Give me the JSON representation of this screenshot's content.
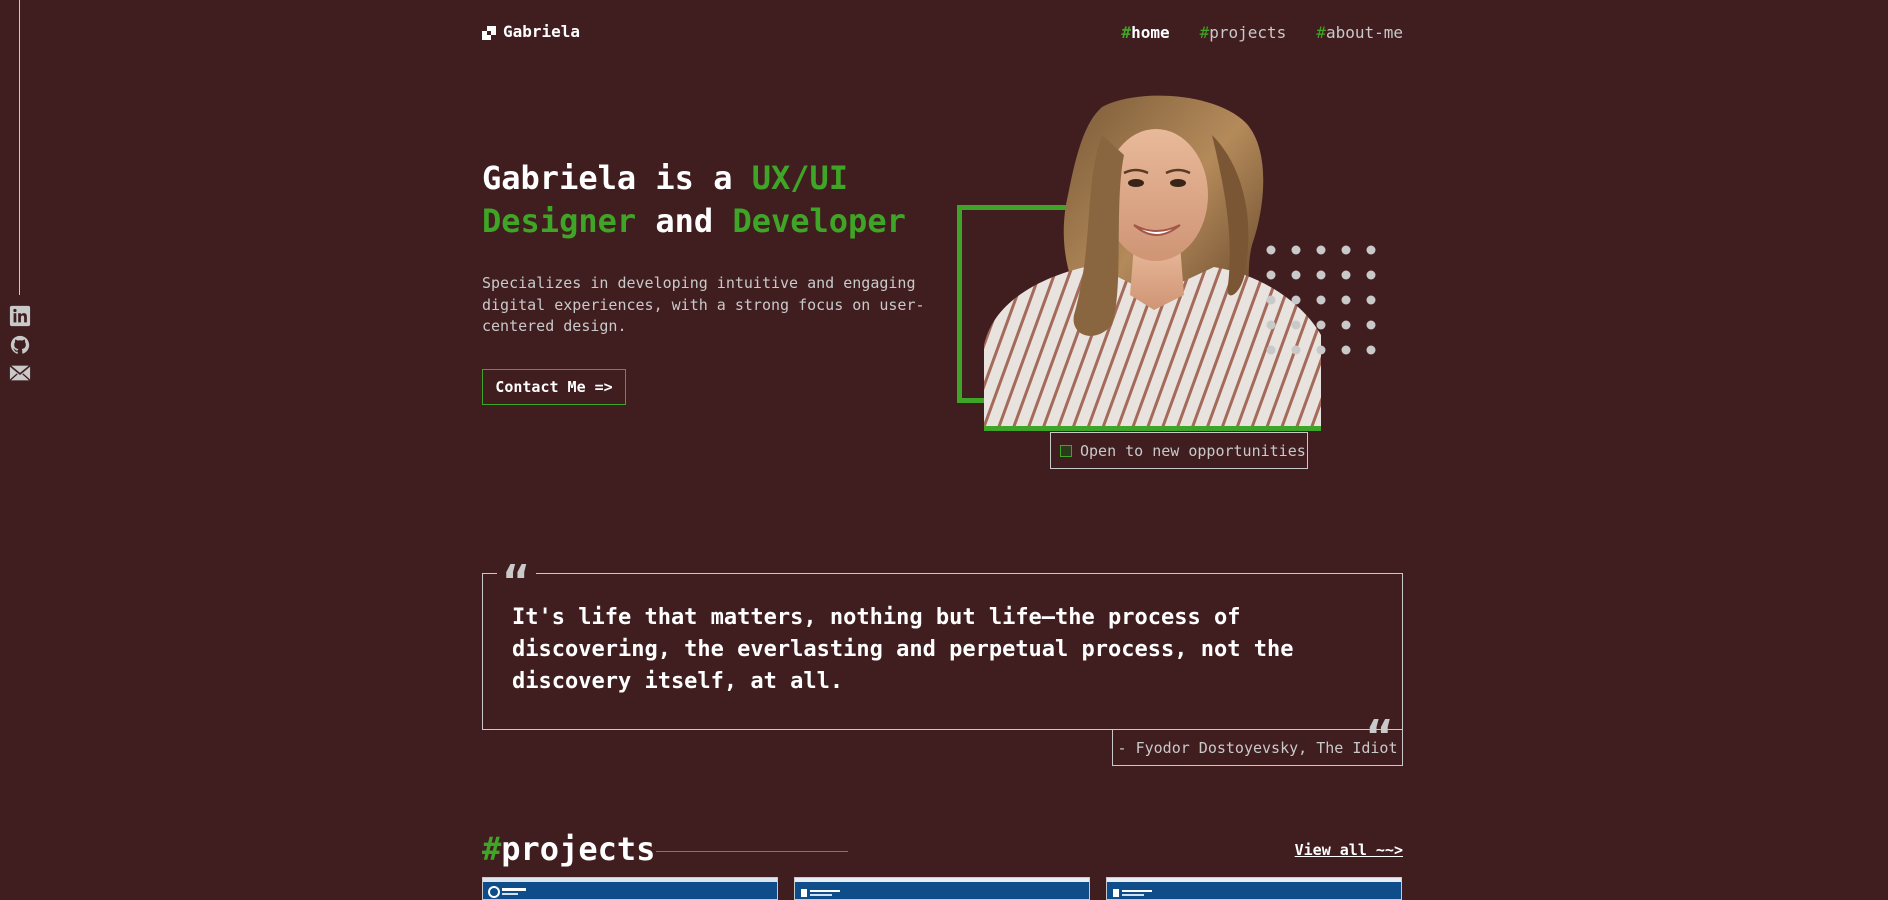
{
  "brand": {
    "name": "Gabriela"
  },
  "nav": {
    "hash": "#",
    "items": [
      {
        "label": "home",
        "active": true
      },
      {
        "label": "projects",
        "active": false
      },
      {
        "label": "about-me",
        "active": false
      }
    ]
  },
  "social": {
    "icons": [
      "linkedin-icon",
      "github-icon",
      "mail-icon"
    ]
  },
  "hero": {
    "title_part1": "Gabriela is a ",
    "title_highlight1": "UX/UI Designer",
    "title_part2": " and ",
    "title_highlight2": "Developer",
    "description": "Specializes in developing intuitive and engaging digital experiences, with a strong focus on user-centered design.",
    "cta_label": "Contact Me =>",
    "status_text": "Open to new opportunities"
  },
  "quote": {
    "text": "It's life that matters, nothing but life—the process of discovering, the everlasting and perpetual process, not the discovery itself, at all.",
    "mark": "“",
    "author": "- Fyodor Dostoyevsky, The Idiot"
  },
  "projects": {
    "hash": "#",
    "title": "projects",
    "view_all_label": "View all ~~>"
  },
  "colors": {
    "background": "#401e20",
    "accent": "#3fa526",
    "muted": "#c9c9c9",
    "text": "#ffffff"
  }
}
